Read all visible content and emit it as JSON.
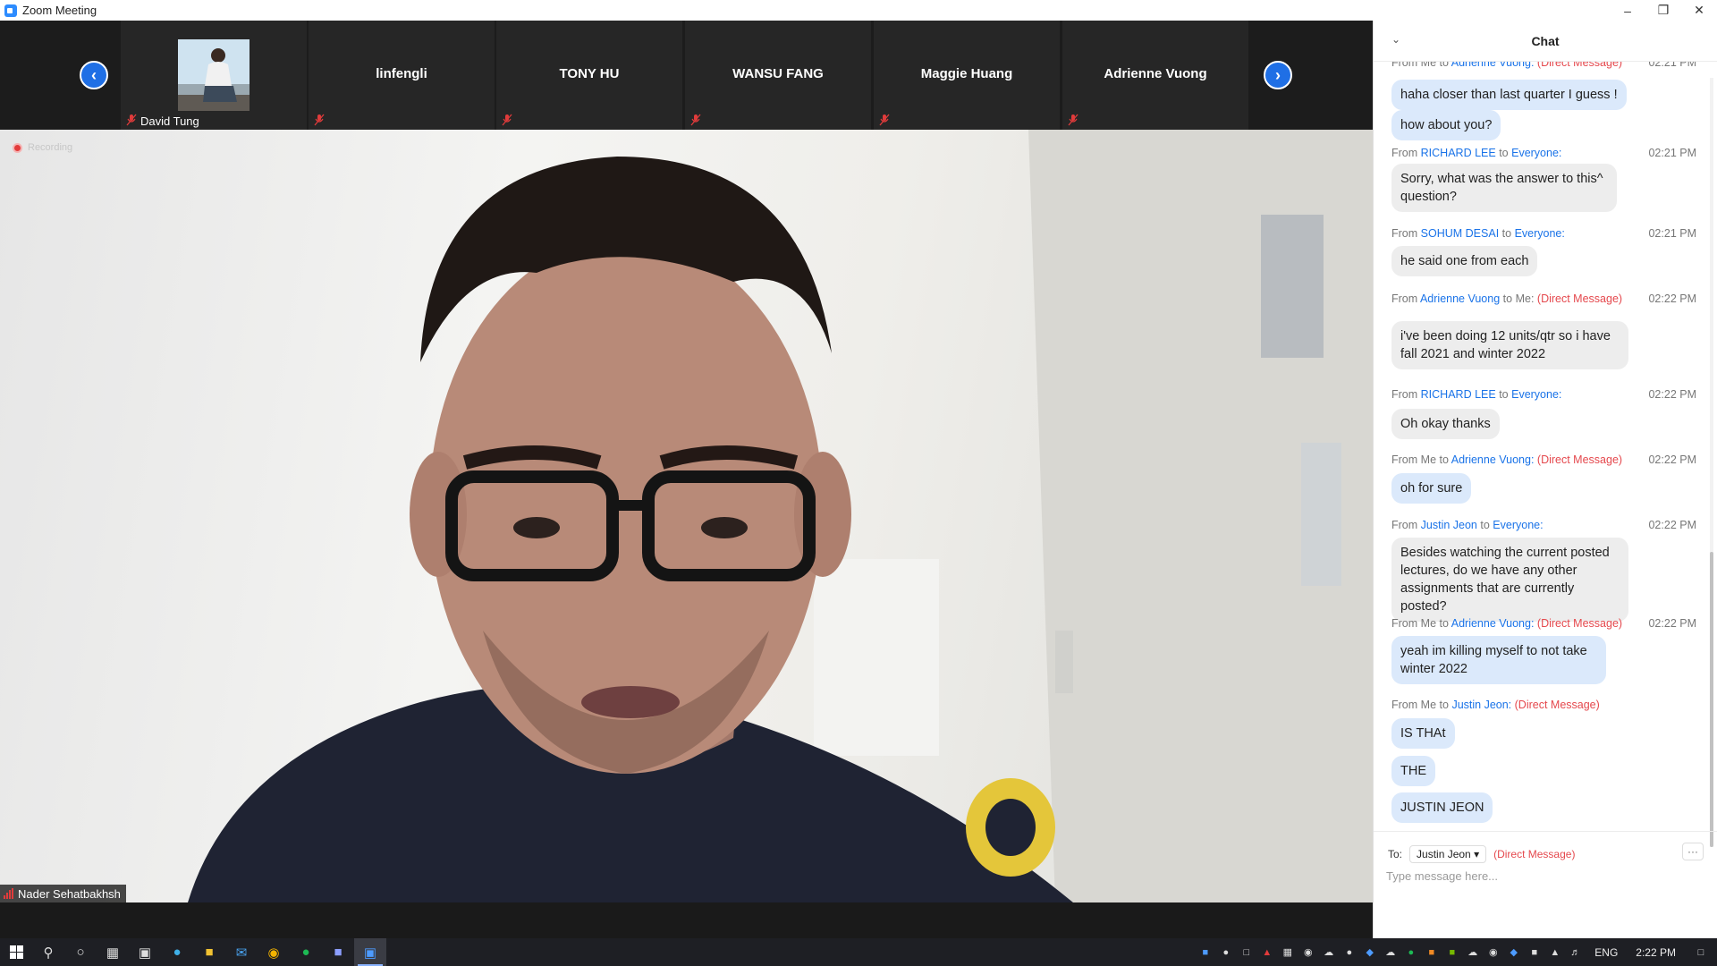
{
  "window": {
    "title": "Zoom Meeting"
  },
  "filmstrip": {
    "participants": [
      {
        "name": "David Tung",
        "muted": true,
        "has_video": true
      },
      {
        "name": "linfengli",
        "muted": true,
        "has_video": false
      },
      {
        "name": "TONY HU",
        "muted": true,
        "has_video": false
      },
      {
        "name": "WANSU FANG",
        "muted": true,
        "has_video": false
      },
      {
        "name": "Maggie Huang",
        "muted": true,
        "has_video": false
      },
      {
        "name": "Adrienne Vuong",
        "muted": true,
        "has_video": false
      }
    ]
  },
  "main_video": {
    "recording_label": "Recording",
    "speaker_name": "Nader Sehatbakhsh"
  },
  "chat": {
    "title": "Chat",
    "messages": [
      {
        "prefix": "From",
        "from": "Me",
        "to_word": "to",
        "to": "Adrienne Vuong:",
        "dm": "(Direct Message)",
        "time": "02:21 PM",
        "partial": true
      },
      {
        "text": "haha closer than last quarter I guess !",
        "mine": true
      },
      {
        "text": "how about you?",
        "mine": true
      },
      {
        "prefix": "From",
        "from": "RICHARD LEE",
        "to_word": "to",
        "to": "Everyone:",
        "dm": "",
        "time": "02:21 PM"
      },
      {
        "text": "Sorry, what was the answer to this^ question?",
        "mine": false
      },
      {
        "prefix": "From",
        "from": "SOHUM DESAI",
        "to_word": "to",
        "to": "Everyone:",
        "dm": "",
        "time": "02:21 PM"
      },
      {
        "text": "he said one from each",
        "mine": false
      },
      {
        "prefix": "From",
        "from": "Adrienne Vuong",
        "to_word": "to",
        "to": "Me:",
        "dm": "(Direct Message)",
        "time": "02:22 PM"
      },
      {
        "text": "i've been doing 12 units/qtr so i have fall 2021 and winter 2022",
        "mine": false
      },
      {
        "prefix": "From",
        "from": "RICHARD LEE",
        "to_word": "to",
        "to": "Everyone:",
        "dm": "",
        "time": "02:22 PM"
      },
      {
        "text": "Oh okay thanks",
        "mine": false
      },
      {
        "prefix": "From",
        "from": "Me",
        "to_word": "to",
        "to": "Adrienne Vuong:",
        "dm": "(Direct Message)",
        "time": "02:22 PM"
      },
      {
        "text": "oh for sure",
        "mine": true
      },
      {
        "prefix": "From",
        "from": "Justin Jeon",
        "to_word": "to",
        "to": "Everyone:",
        "dm": "",
        "time": "02:22 PM"
      },
      {
        "text": "Besides watching the current posted lectures, do we have any other assignments that are currently posted?",
        "mine": false
      },
      {
        "prefix": "From",
        "from": "Me",
        "to_word": "to",
        "to": "Adrienne Vuong:",
        "dm": "(Direct Message)",
        "time": "02:22 PM"
      },
      {
        "text": "yeah im killing myself to not take winter 2022",
        "mine": true
      },
      {
        "prefix": "From",
        "from": "Me",
        "to_word": "to",
        "to": "Justin Jeon:",
        "dm": "(Direct Message)",
        "time": ""
      },
      {
        "text": "IS THAt",
        "mine": true
      },
      {
        "text": "THE",
        "mine": true
      },
      {
        "text": "JUSTIN JEON",
        "mine": true
      }
    ],
    "composer": {
      "to_label": "To:",
      "recipient": "Justin Jeon",
      "dm_label": "(Direct Message)",
      "more_label": "···",
      "placeholder": "Type message here..."
    }
  },
  "taskbar": {
    "language": "ENG",
    "time": "2:22 PM"
  }
}
